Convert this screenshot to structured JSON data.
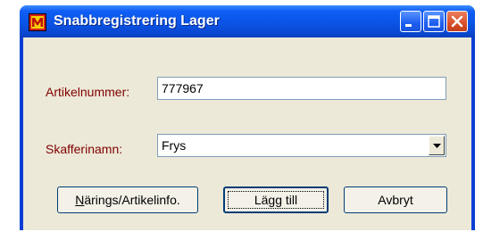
{
  "window": {
    "title": "Snabbregistrering Lager",
    "icon": "app-icon"
  },
  "titlebar_buttons": {
    "minimize": "minimize-icon",
    "maximize": "maximize-icon",
    "close": "close-icon"
  },
  "form": {
    "article_label": "Artikelnummer:",
    "article_value": "777967",
    "pantry_label": "Skafferinamn:",
    "pantry_value": "Frys"
  },
  "buttons": {
    "nutrition_mnemonic": "N",
    "nutrition_rest": "ärings/Artikelinfo.",
    "add_label": "Lägg till",
    "cancel_label": "Avbryt"
  },
  "colors": {
    "titlebar": "#0a54e6",
    "label_text": "#800000",
    "dialog_bg": "#ece9d8"
  }
}
